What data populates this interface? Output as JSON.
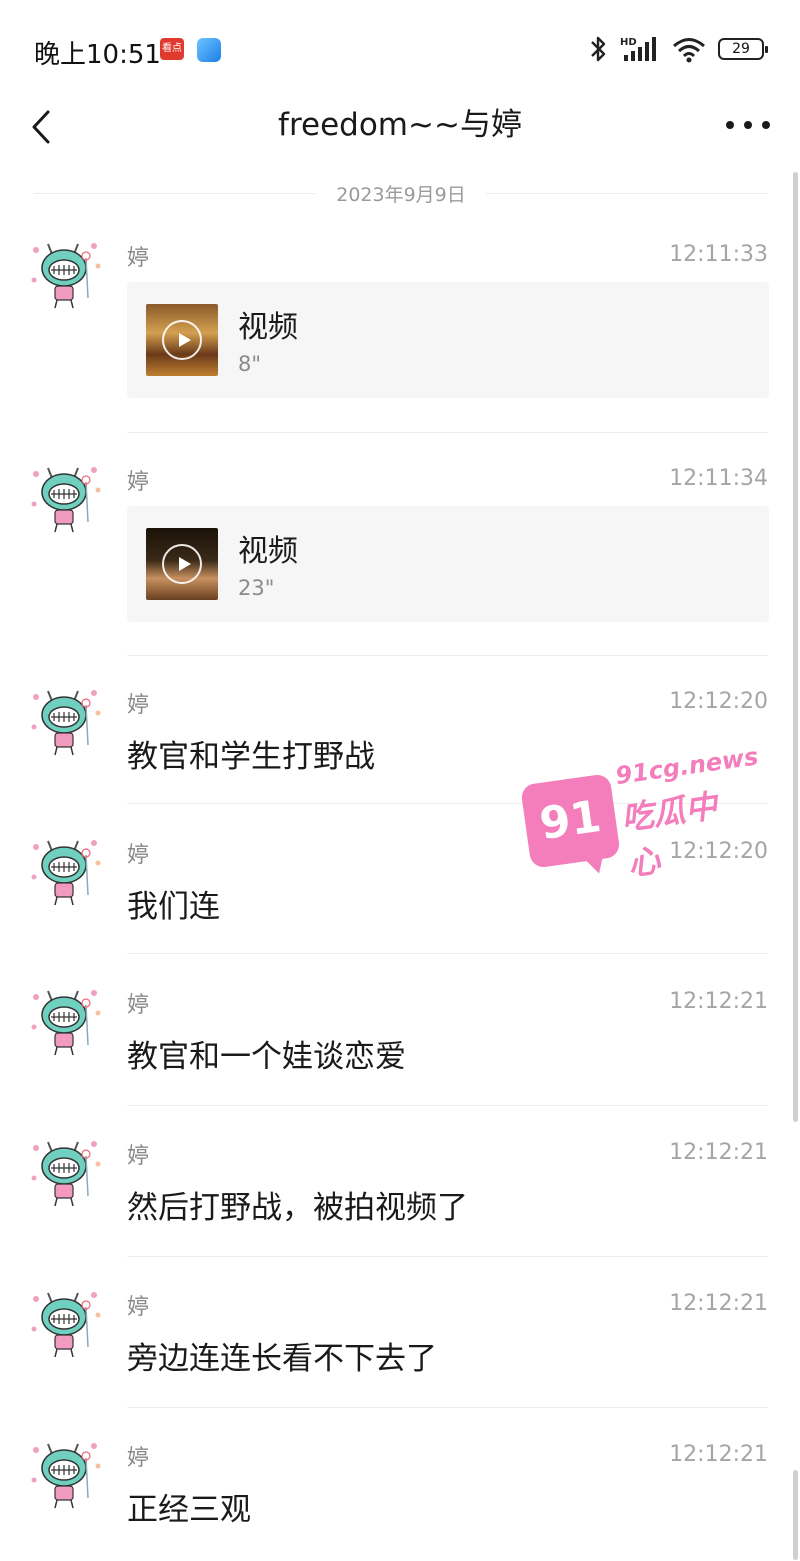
{
  "status_bar": {
    "time": "晚上10:51",
    "badge_text": "看点",
    "network": "HD",
    "battery": "29"
  },
  "nav": {
    "title": "freedom~~与婷"
  },
  "date_separator": "2023年9月9日",
  "messages": [
    {
      "sender": "婷",
      "time": "12:11:33",
      "type": "video",
      "label": "视频",
      "duration": "8\""
    },
    {
      "sender": "婷",
      "time": "12:11:34",
      "type": "video",
      "label": "视频",
      "duration": "23\""
    },
    {
      "sender": "婷",
      "time": "12:12:20",
      "type": "text",
      "text": "教官和学生打野战"
    },
    {
      "sender": "婷",
      "time": "12:12:20",
      "type": "text",
      "text": "我们连"
    },
    {
      "sender": "婷",
      "time": "12:12:21",
      "type": "text",
      "text": "教官和一个娃谈恋爱"
    },
    {
      "sender": "婷",
      "time": "12:12:21",
      "type": "text",
      "text": "然后打野战，被拍视频了"
    },
    {
      "sender": "婷",
      "time": "12:12:21",
      "type": "text",
      "text": "旁边连连长看不下去了"
    },
    {
      "sender": "婷",
      "time": "12:12:21",
      "type": "text",
      "text": "正经三观"
    }
  ],
  "watermark": {
    "badge": "91",
    "site": "91cg.news",
    "name": "吃瓜中心"
  },
  "icons": {
    "back": "chevron-left-icon",
    "more": "more-dots-icon",
    "avatar": "cartoon-avatar"
  }
}
